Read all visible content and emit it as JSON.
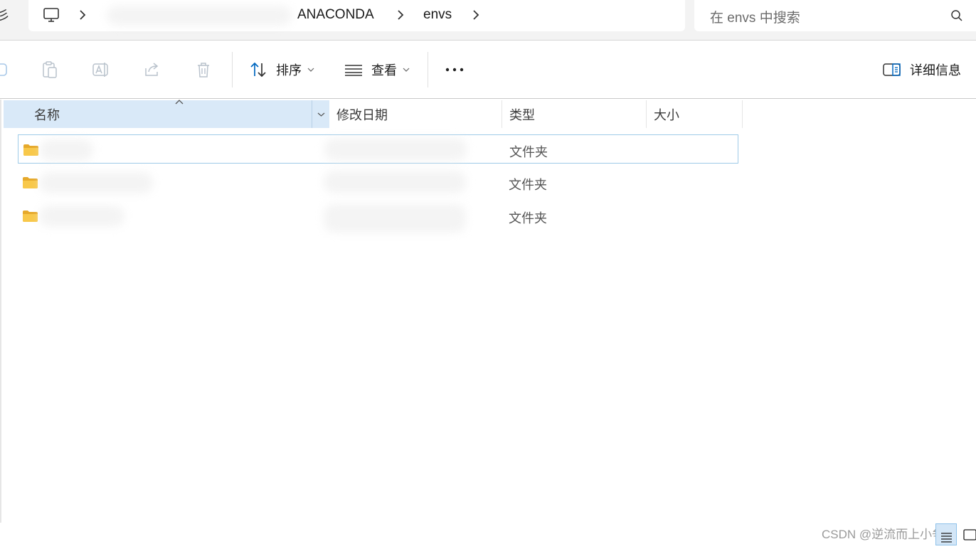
{
  "address_bar": {
    "edge_glyph": "彡",
    "breadcrumbs": [
      "ANACONDA",
      "envs"
    ]
  },
  "search": {
    "placeholder": "在 envs 中搜索"
  },
  "toolbar": {
    "sort_label": "排序",
    "view_label": "查看",
    "details_label": "详细信息"
  },
  "columns": {
    "name": "名称",
    "date_modified": "修改日期",
    "type": "类型",
    "size": "大小"
  },
  "rows": [
    {
      "name": "",
      "date_modified": "",
      "type": "文件夹",
      "size": "",
      "selected": true
    },
    {
      "name": "",
      "date_modified": "",
      "type": "文件夹",
      "size": "",
      "selected": false
    },
    {
      "name": "",
      "date_modified": "",
      "type": "文件夹",
      "size": "",
      "selected": false
    }
  ],
  "watermark": "CSDN @逆流而上小争",
  "colors": {
    "accent": "#0067c0",
    "selected_header": "#d9e9f8",
    "folder": "#f8c84a"
  }
}
